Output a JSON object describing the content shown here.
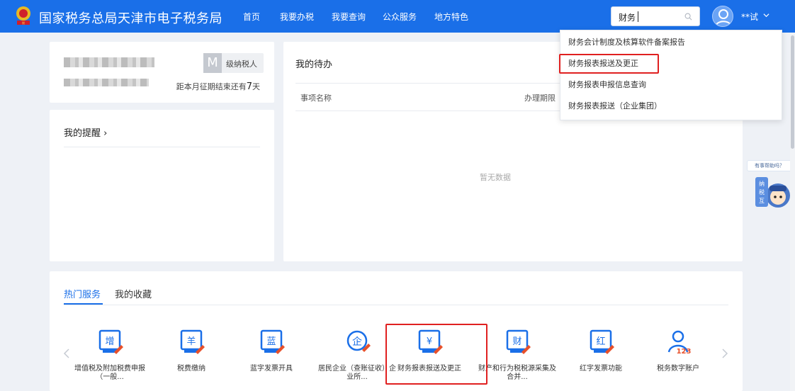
{
  "header": {
    "brand": "国家税务总局天津市电子税务局",
    "nav": [
      "首页",
      "我要办税",
      "我要查询",
      "公众服务",
      "地方特色"
    ],
    "search_value": "财务",
    "user_name": "**试"
  },
  "taxpayer": {
    "level_letter": "M",
    "level_text": "级纳税人",
    "deadline_prefix": "距本月征期结束还有",
    "deadline_days": "7",
    "deadline_suffix": "天"
  },
  "reminder": {
    "title": "我的提醒 ›"
  },
  "todo": {
    "title": "我的待办",
    "columns": [
      "事项名称",
      "办理期限"
    ],
    "empty_text": "暂无数据"
  },
  "services": {
    "tabs": [
      "热门服务",
      "我的收藏"
    ],
    "items": [
      {
        "icon": "zeng",
        "label": "增值税及附加税费申报（一般..."
      },
      {
        "icon": "yang",
        "label": "税费缴纳"
      },
      {
        "icon": "lan",
        "label": "蓝字发票开具"
      },
      {
        "icon": "qi",
        "label": "居民企业（查账征收）企业所..."
      },
      {
        "icon": "yuan",
        "label": "财务报表报送及更正"
      },
      {
        "icon": "cai",
        "label": "财产和行为税税源采集及合并..."
      },
      {
        "icon": "hong",
        "label": "红字发票功能"
      },
      {
        "icon": "user123",
        "label": "税务数字账户"
      }
    ],
    "icon_glyphs": {
      "zeng": "增",
      "yang": "羊",
      "lan": "蓝",
      "qi": "企",
      "yuan": "¥",
      "cai": "财",
      "hong": "红",
      "user123": "123"
    }
  },
  "dropdown": {
    "items": [
      "财务会计制度及核算软件备案报告",
      "财务报表报送及更正",
      "财务报表申报信息查询",
      "财务报表报送（企业集团）"
    ]
  },
  "help": {
    "bubble": "有事帮助吗？",
    "mascot_text": "纳税互动"
  },
  "colors": {
    "primary": "#1a6fe8",
    "highlight": "#e02020",
    "accent": "#e8502a"
  }
}
